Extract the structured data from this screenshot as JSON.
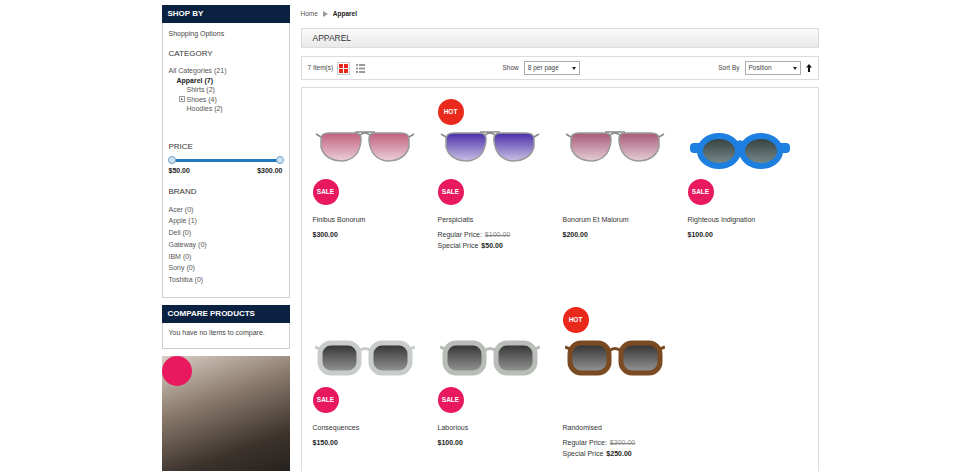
{
  "breadcrumb": {
    "items": [
      {
        "label": "Home",
        "selected": false
      },
      {
        "label": "Apparel",
        "selected": true
      }
    ]
  },
  "sidebar": {
    "title": "SHOP BY",
    "subtitle": "Shopping Options",
    "category": {
      "heading": "CATEGORY",
      "items": [
        {
          "label": "All Categories (21)",
          "kind": "root",
          "selected": false
        },
        {
          "label": "Apparel (7)",
          "kind": "current",
          "selected": true
        },
        {
          "label": "Shirts (2)",
          "kind": "child",
          "selected": false
        },
        {
          "label": "Shoes (4)",
          "kind": "child-collapsed",
          "selected": false
        },
        {
          "label": "Hoodies (2)",
          "kind": "child",
          "selected": false
        }
      ]
    },
    "price": {
      "heading": "PRICE",
      "level": 1,
      "min": "$50.00",
      "max": "$300.00"
    },
    "brand": {
      "heading": "BRAND",
      "items": [
        "Acer (0)",
        "Apple (1)",
        "Dell (0)",
        "Gateway (0)",
        "IBM (0)",
        "Sony (0)",
        "Toshiba (0)"
      ]
    }
  },
  "compare": {
    "title": "COMPARE PRODUCTS",
    "message": "You have no items to compare."
  },
  "page": {
    "title": "APPAREL"
  },
  "toolbar": {
    "count": "7 Item(s)",
    "views": [
      {
        "kind": "grid",
        "selected": true
      },
      {
        "kind": "list",
        "selected": false
      }
    ],
    "show_label": "Show",
    "per_page": "8 per page",
    "sort_label": "Sort By",
    "sort": "Position"
  },
  "products": [
    {
      "name": "Finibus Bonorum",
      "kind": "aviator",
      "color": "#c0607e",
      "badges": [
        {
          "label": "SALE",
          "kind": "sale"
        }
      ],
      "price": {
        "kind": "single",
        "value": "$300.00"
      }
    },
    {
      "name": "Perspiciatis",
      "kind": "aviator",
      "color": "#4a2fa8",
      "badges": [
        {
          "label": "HOT",
          "kind": "hot"
        },
        {
          "label": "SALE",
          "kind": "sale"
        }
      ],
      "price": {
        "kind": "special",
        "regular_label": "Regular Price:",
        "regular": "$100.00",
        "special_label": "Special Price",
        "special": "$50.00"
      }
    },
    {
      "name": "Bonorum Et Malorum",
      "kind": "aviator",
      "color": "#a85a78",
      "badges": [],
      "price": {
        "kind": "single",
        "value": "$200.00"
      }
    },
    {
      "name": "Righteous Indignation",
      "kind": "kids",
      "color": "#1d7fe0",
      "badges": [
        {
          "label": "SALE",
          "kind": "sale"
        }
      ],
      "price": {
        "kind": "single",
        "value": "$100.00"
      }
    },
    {
      "name": "Consequences",
      "kind": "square",
      "color": "#c9cdc9",
      "badges": [
        {
          "label": "SALE",
          "kind": "sale"
        }
      ],
      "price": {
        "kind": "single",
        "value": "$150.00"
      }
    },
    {
      "name": "Laborious",
      "kind": "square",
      "color": "#b9bdb8",
      "badges": [
        {
          "label": "SALE",
          "kind": "sale"
        }
      ],
      "price": {
        "kind": "single",
        "value": "$100.00"
      }
    },
    {
      "name": "Randomised",
      "kind": "square",
      "color": "#7a4a22",
      "badges": [
        {
          "label": "HOT",
          "kind": "hot"
        }
      ],
      "price": {
        "kind": "special",
        "regular_label": "Regular Price:",
        "regular": "$300.00",
        "special_label": "Special Price",
        "special": "$250.00"
      }
    }
  ]
}
